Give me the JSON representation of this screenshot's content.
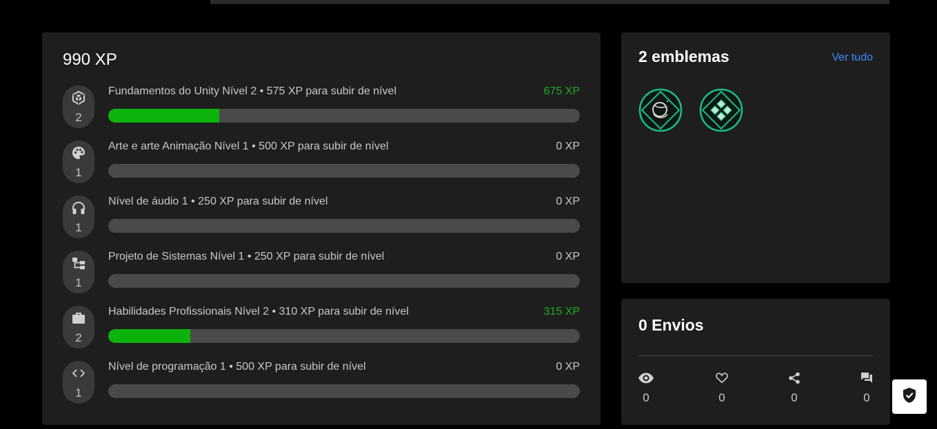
{
  "xp_panel": {
    "total": "990 XP",
    "skills": [
      {
        "icon": "unity-icon",
        "level": "2",
        "title": "Fundamentos do Unity Nível 2",
        "sep": "•",
        "next": "575 XP para subir de nível",
        "xp": "675 XP",
        "progress": 0.235,
        "highlight": true
      },
      {
        "icon": "palette-icon",
        "level": "1",
        "title": "Arte e arte Animação Nível 1",
        "sep": "•",
        "next": "500 XP para subir de nível",
        "xp": "0 XP",
        "progress": 0,
        "highlight": false
      },
      {
        "icon": "headphones-icon",
        "level": "1",
        "title": "Nível de áudio 1",
        "sep": "•",
        "next": "250 XP para subir de nível",
        "xp": "0 XP",
        "progress": 0,
        "highlight": false
      },
      {
        "icon": "hierarchy-icon",
        "level": "1",
        "title": "Projeto de Sistemas Nível 1",
        "sep": "•",
        "next": "250 XP para subir de nível",
        "xp": "0 XP",
        "progress": 0,
        "highlight": false
      },
      {
        "icon": "briefcase-icon",
        "level": "2",
        "title": "Habilidades Profissionais Nível 2",
        "sep": "•",
        "next": "310 XP para subir de nível",
        "xp": "315 XP",
        "progress": 0.174,
        "highlight": true
      },
      {
        "icon": "code-icon",
        "level": "1",
        "title": "Nível de programação 1",
        "sep": "•",
        "next": "500 XP para subir de nível",
        "xp": "0 XP",
        "progress": 0,
        "highlight": false
      }
    ]
  },
  "badges_panel": {
    "title": "2 emblemas",
    "view_all": "Ver tudo",
    "badges": [
      {
        "icon": "planet-badge-icon"
      },
      {
        "icon": "diamonds-badge-icon"
      }
    ]
  },
  "envios_panel": {
    "title": "0 Envios",
    "stats": [
      {
        "icon": "eye-icon",
        "value": "0"
      },
      {
        "icon": "heart-icon",
        "value": "0"
      },
      {
        "icon": "share-icon",
        "value": "0"
      },
      {
        "icon": "comments-icon",
        "value": "0"
      }
    ]
  },
  "colors": {
    "accent_green": "#0db30d",
    "link_blue": "#3d8bff",
    "card_bg": "#1e1e1e"
  }
}
